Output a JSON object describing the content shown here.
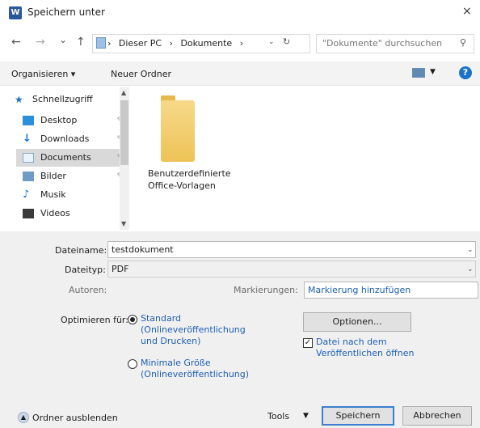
{
  "window": {
    "title": "Speichern unter",
    "app_icon": "word-icon",
    "close": "×"
  },
  "nav": {
    "back": "←",
    "forward": "→",
    "recent": "⌄",
    "up": "↑",
    "breadcrumbs": [
      "Dieser PC",
      "Dokumente"
    ],
    "separator": "›",
    "refresh": "↻",
    "search_placeholder": "\"Dokumente\" durchsuchen"
  },
  "toolbar": {
    "organize": "Organisieren ▾",
    "new_folder": "Neuer Ordner",
    "help": "?"
  },
  "sidebar": {
    "items": [
      {
        "label": "Schnellzugriff",
        "icon": "star-icon",
        "pin": ""
      },
      {
        "label": "Desktop",
        "icon": "desktop-icon",
        "pin": "✎"
      },
      {
        "label": "Downloads",
        "icon": "download-icon",
        "pin": "✎"
      },
      {
        "label": "Documents",
        "icon": "document-icon",
        "pin": "✎",
        "selected": true
      },
      {
        "label": "Bilder",
        "icon": "pictures-icon",
        "pin": "✎"
      },
      {
        "label": "Musik",
        "icon": "music-icon",
        "pin": ""
      },
      {
        "label": "Videos",
        "icon": "video-icon",
        "pin": ""
      }
    ]
  },
  "content": {
    "folders": [
      {
        "label": "Benutzerdefinierte Office-Vorlagen"
      }
    ]
  },
  "form": {
    "filename_label": "Dateiname:",
    "filename_value": "testdokument",
    "filetype_label": "Dateityp:",
    "filetype_value": "PDF",
    "authors_label": "Autoren:",
    "tags_label": "Markierungen:",
    "tags_value": "Markierung hinzufügen",
    "optimize_label": "Optimieren für:",
    "opt_standard": "Standard",
    "opt_standard_desc": "(Onlineveröffentlichung und Drucken)",
    "opt_min": "Minimale Größe",
    "opt_min_desc": "(Onlineveröffentlichung)",
    "options_button": "Optionen...",
    "open_after_label": "Datei nach dem Veröffentlichen öffnen",
    "hide_folders": "Ordner ausblenden",
    "tools": "Tools",
    "save": "Speichern",
    "cancel": "Abbrechen"
  }
}
